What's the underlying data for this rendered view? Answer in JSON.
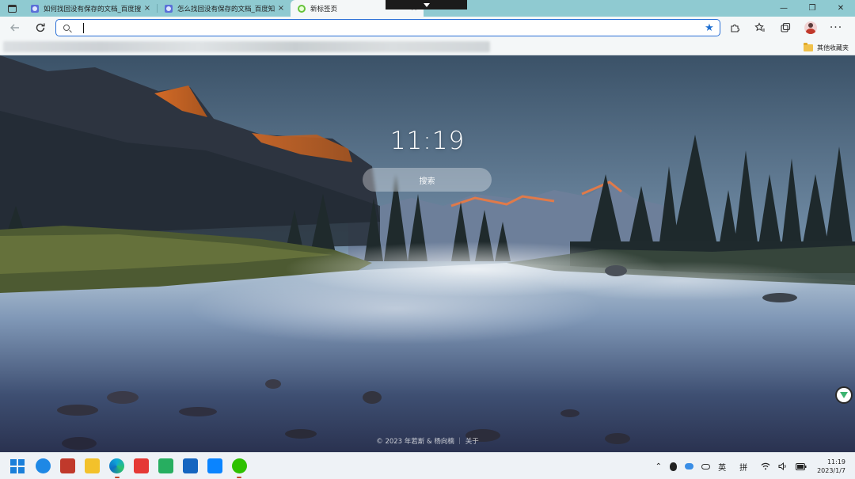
{
  "browser": {
    "tabs": [
      {
        "title": "如何找回没有保存的文档_百度搜",
        "close": "×",
        "active": false
      },
      {
        "title": "怎么找回没有保存的文档_百度知",
        "close": "×",
        "active": false
      },
      {
        "title": "新标签页",
        "close": "×",
        "active": true
      }
    ],
    "window_controls": {
      "minimize": "—",
      "restore": "❐",
      "close": "✕"
    },
    "address": {
      "value": "",
      "placeholder": ""
    },
    "favorites_folder": "其他收藏夹"
  },
  "newtab": {
    "clock": "11:19",
    "search_placeholder": "搜索",
    "footer": "© 2023 年若斯 & 杨向楠 ｜ 关于"
  },
  "taskbar": {
    "ime_lang": "英",
    "ime_mode": "拼",
    "time": "11:19",
    "date": "2023/1/7"
  },
  "colors": {
    "tabbar": "#8fcad1",
    "toolbar": "#f4f7f8",
    "address_border": "#2a6fd6",
    "taskbar": "#eef2f6"
  },
  "icons": [
    "tab-actions-icon",
    "favicon",
    "close-icon",
    "back-icon",
    "refresh-icon",
    "search-icon",
    "favorite-star-icon",
    "extensions-icon",
    "favorites-icon",
    "collections-icon",
    "profile-avatar",
    "more-icon",
    "folder-icon",
    "feedback-icon",
    "windows-start-icon",
    "edge-icon",
    "wps-icon",
    "file-explorer-icon",
    "wechat-icon",
    "wifi-icon",
    "volume-icon",
    "battery-icon"
  ]
}
